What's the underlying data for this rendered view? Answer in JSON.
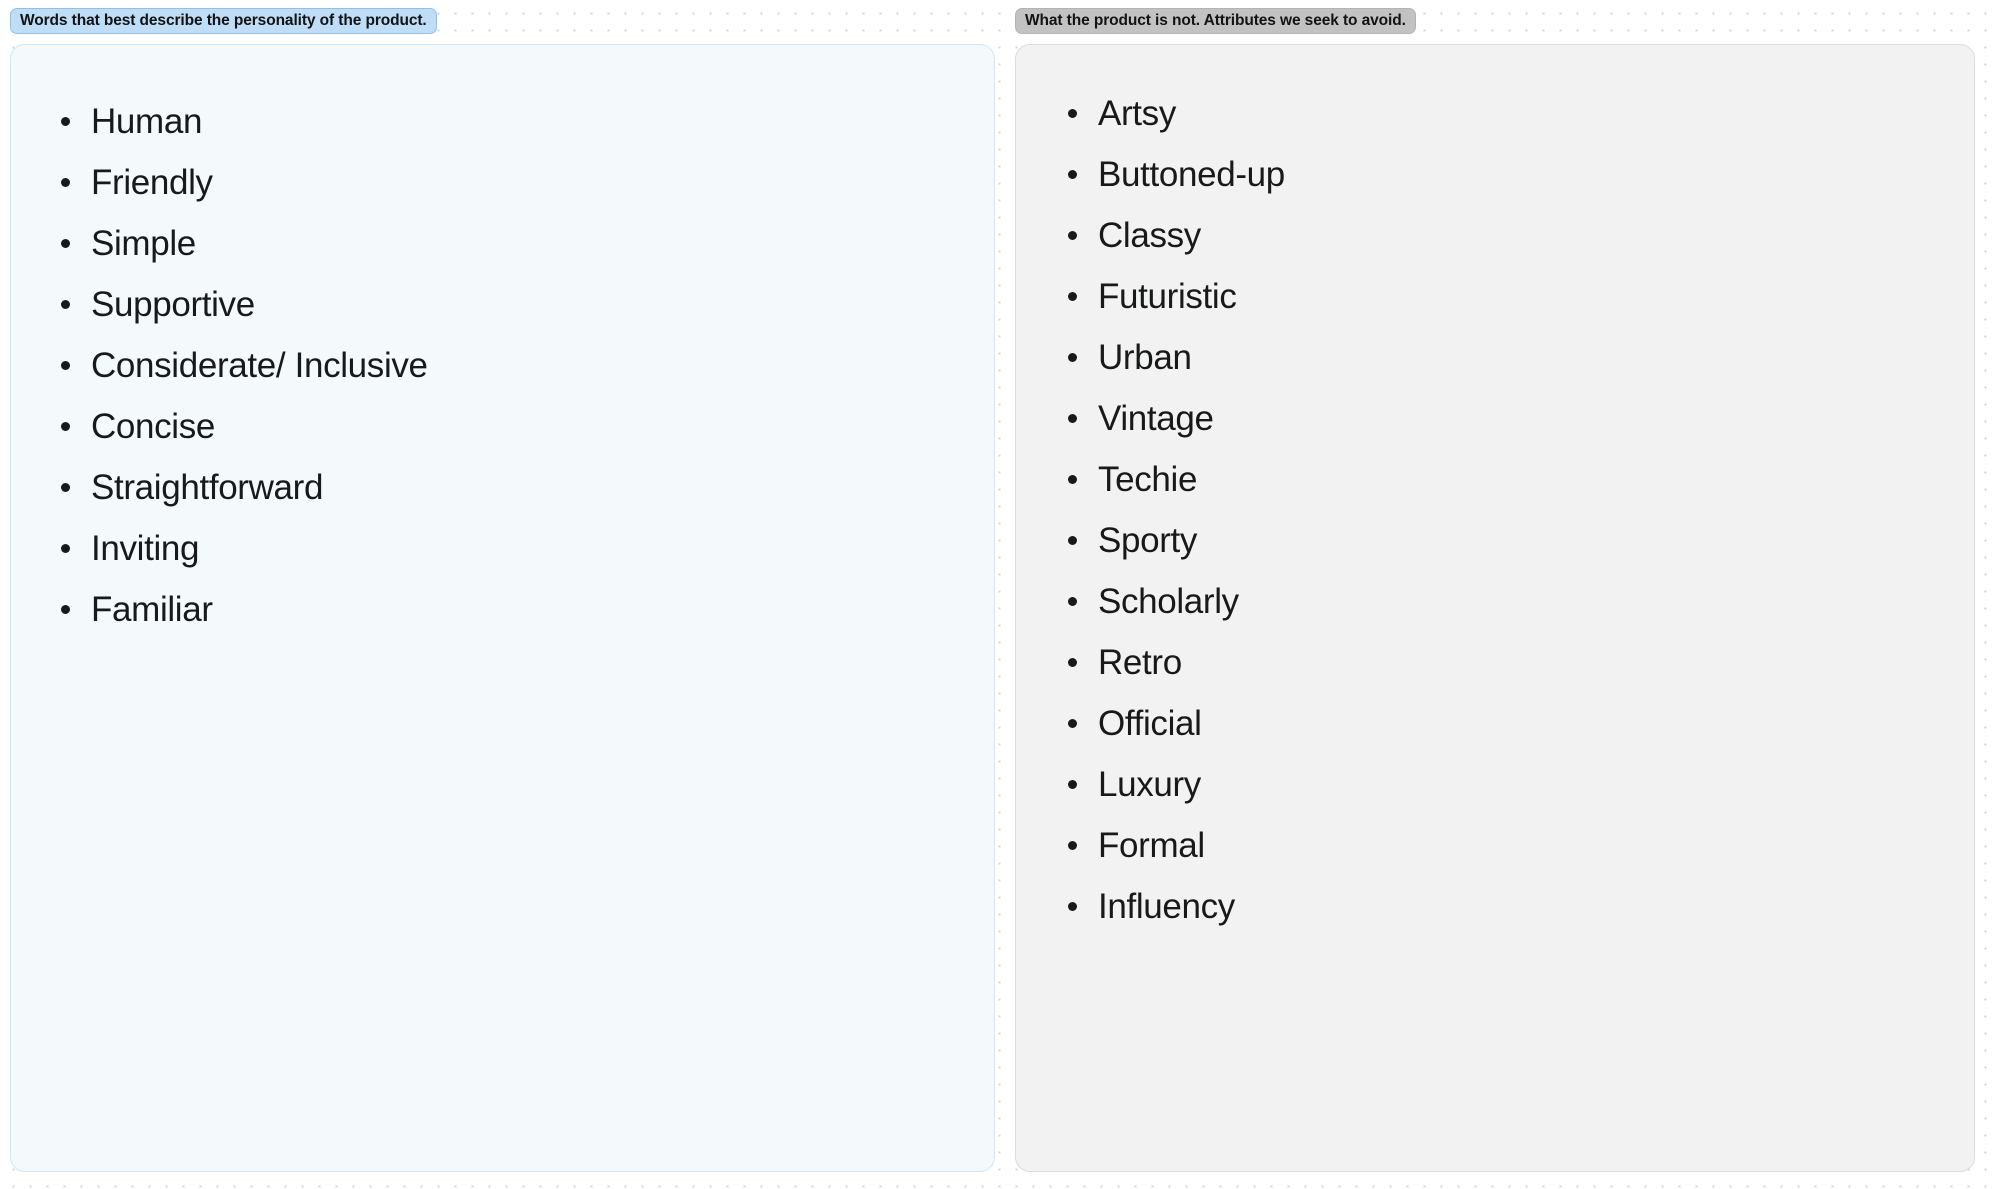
{
  "board": {
    "background": "#ffffff",
    "dot_color": "#d4d4d4"
  },
  "columns": [
    {
      "id": "personality",
      "header_label": "Words that best describe the personality of the product.",
      "accent_color": "#bfddf7",
      "panel_color": "#f4f9fc",
      "items": [
        "Human",
        "Friendly",
        "Simple",
        "Supportive",
        "Considerate/ Inclusive",
        "Concise",
        "Straightforward",
        "Inviting",
        "Familiar"
      ]
    },
    {
      "id": "avoid",
      "header_label": "What the product is not. Attributes we seek to avoid.",
      "accent_color": "#c2c2c2",
      "panel_color": "#f2f2f2",
      "items": [
        "Artsy",
        "Buttoned-up",
        "Classy",
        "Futuristic",
        "Urban",
        "Vintage",
        "Techie",
        "Sporty",
        "Scholarly",
        "Retro",
        "Official",
        "Luxury",
        "Formal",
        "Influency"
      ]
    }
  ]
}
